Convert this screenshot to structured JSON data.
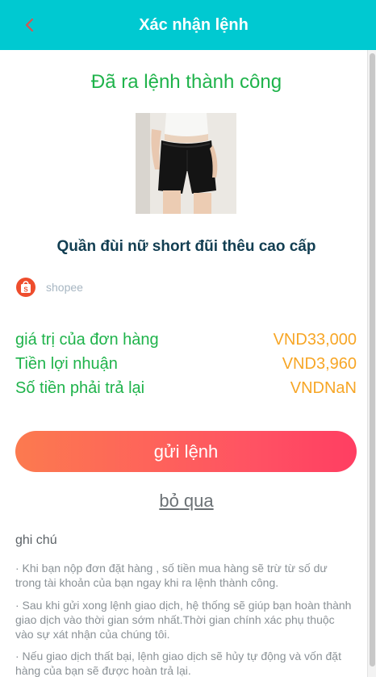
{
  "header": {
    "title": "Xác nhận lệnh",
    "back_icon": "chevron-left-icon"
  },
  "colors": {
    "header": "#00c9d1",
    "success": "#1fb34b",
    "amount": "#f7a626",
    "button_start": "#fc7a4f",
    "button_end": "#ff3e62"
  },
  "main": {
    "success_message": "Đã ra lệnh thành công",
    "product": {
      "image_icon": "product-photo-black-shorts",
      "name": "Quần đùi nữ short đũi thêu cao cấp"
    },
    "platform": {
      "icon": "shopee-bag-icon",
      "label": "shopee"
    },
    "summary": [
      {
        "label": "giá trị của đơn hàng",
        "value": "VND33,000"
      },
      {
        "label": "Tiền lợi nhuận",
        "value": "VND3,960"
      },
      {
        "label": "Số tiền phải trả lại",
        "value": "VNDNaN"
      }
    ],
    "submit_label": "gửi lệnh",
    "skip_label": "bỏ qua"
  },
  "notes": {
    "title": "ghi chú",
    "items": [
      "· Khi bạn nộp đơn đặt hàng , số tiền mua hàng sẽ trừ từ số dư trong tài khoản của bạn ngay khi ra lệnh thành công.",
      "· Sau khi gửi xong lệnh giao dịch, hệ thống sẽ giúp bạn hoàn thành giao dịch vào thời gian sớm nhất.Thời gian chính xác phụ thuộc vào sự xát nhận của chúng tôi.",
      "· Nếu giao dịch thất bại, lệnh giao dịch sẽ hủy tự động và vốn đặt hàng của bạn sẽ được hoàn trả lại."
    ]
  }
}
